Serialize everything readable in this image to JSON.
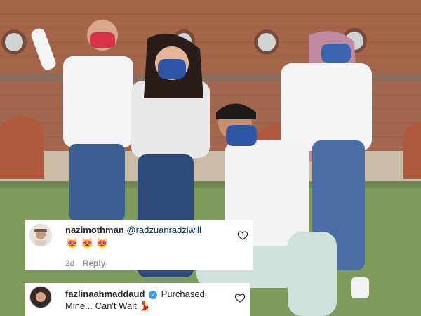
{
  "photo": {
    "description_icon": "group-photo"
  },
  "comments": [
    {
      "username": "nazimothman",
      "mention": "@radzuanradziwill",
      "emojis": [
        "😻",
        "😻",
        "😻"
      ],
      "time": "2d",
      "reply_label": "Reply"
    },
    {
      "username": "fazlinaahmaddaud",
      "text_line1": "Purchased",
      "text_line2": "Mine... Can't Wait",
      "emoji": "💃"
    }
  ],
  "colors": {
    "mention": "#00376b",
    "verified": "#3897f0",
    "meta": "#8e8e8e"
  }
}
